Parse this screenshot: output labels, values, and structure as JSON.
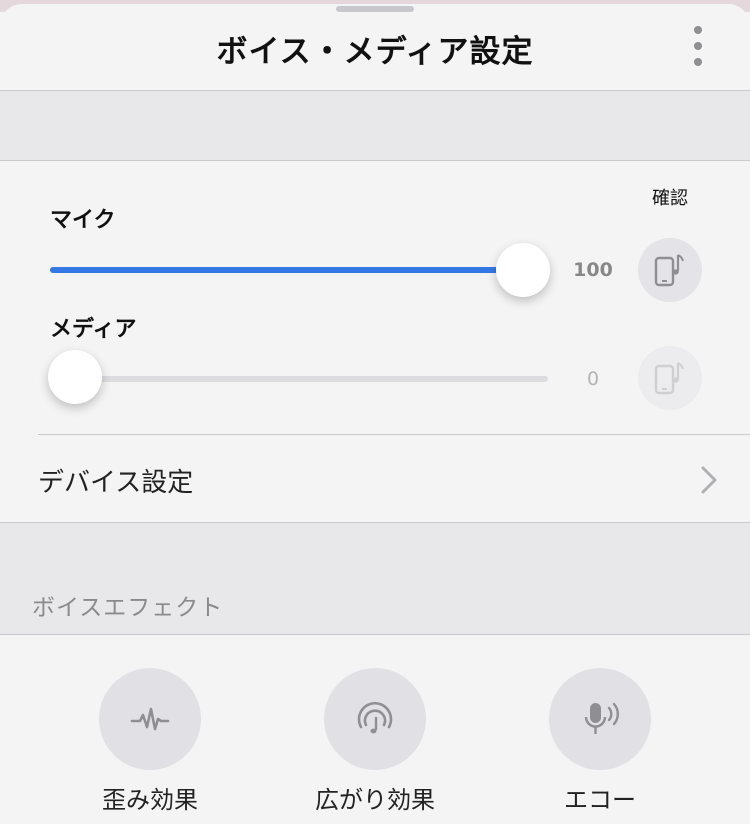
{
  "header": {
    "title": "ボイス・メディア設定",
    "menu_icon": "more-vertical-icon"
  },
  "volume": {
    "confirm_label": "確認",
    "mic": {
      "label": "マイク",
      "value": "100",
      "level": 1.0,
      "test_icon": "phone-music-icon",
      "test_enabled": true
    },
    "media": {
      "label": "メディア",
      "value": "0",
      "level": 0.0,
      "test_icon": "phone-music-icon",
      "test_enabled": false
    }
  },
  "device_settings": {
    "label": "デバイス設定",
    "icon": "chevron-right-icon"
  },
  "voice_effect": {
    "section_title": "ボイスエフェクト",
    "items": [
      {
        "label": "歪み効果",
        "icon": "waveform-icon"
      },
      {
        "label": "広がり効果",
        "icon": "surround-music-icon"
      },
      {
        "label": "エコー",
        "icon": "microphone-echo-icon"
      }
    ]
  },
  "colors": {
    "accent": "#3478e6",
    "band": "#e8e8ea",
    "button_bg": "#e1e1e5"
  }
}
